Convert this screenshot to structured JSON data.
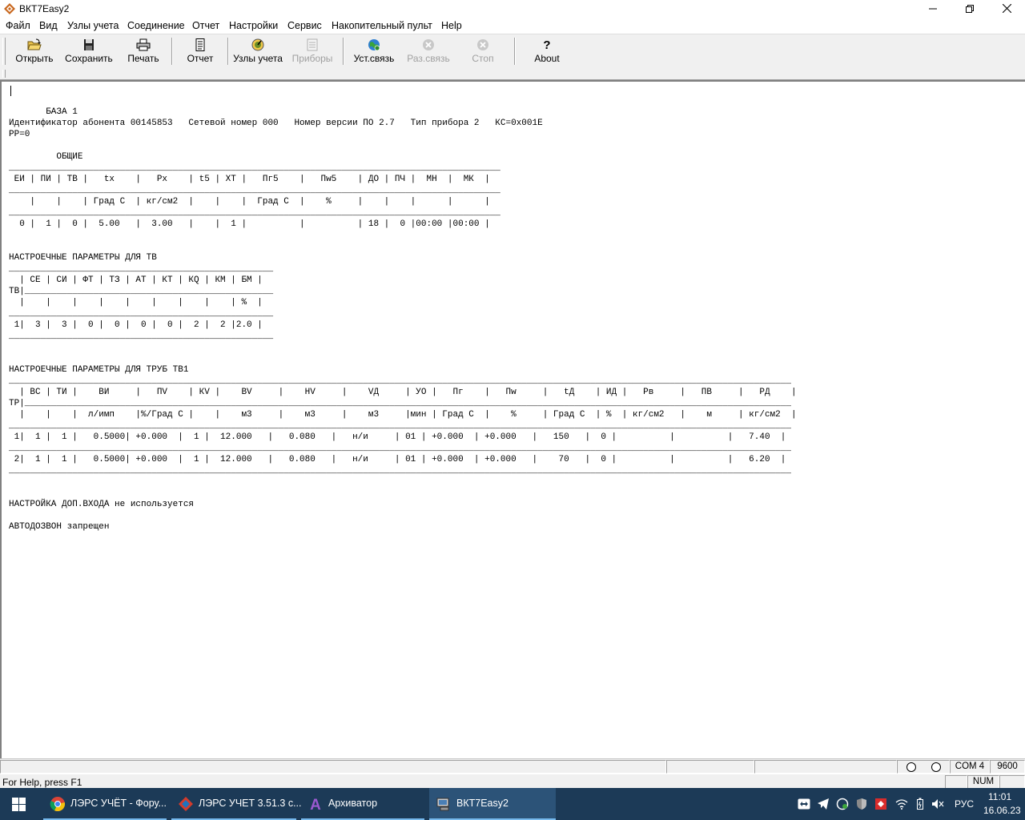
{
  "window": {
    "title": "ВКТ7Easy2"
  },
  "menu": [
    "Файл",
    "Вид",
    "Узлы учета",
    "Соединение",
    "Отчет",
    "Настройки",
    "Сервис",
    "Накопительный пульт",
    "Help"
  ],
  "toolbar": {
    "open": "Открыть",
    "save": "Сохранить",
    "print": "Печать",
    "report": "Отчет",
    "nodes": "Узлы учета",
    "devices": "Приборы",
    "connect": "Уст.связь",
    "disconnect": "Раз.связь",
    "stop": "Стоп",
    "about": "About"
  },
  "document": {
    "lines": [
      "",
      "       БАЗА 1",
      "Идентификатор абонента 00145853   Сетевой номер 000   Номер версии ПО 2.7   Тип прибора 2   КС=0x001E",
      "РР=0",
      "",
      "         ОБЩИЕ",
      "_____________________________________________________________________________________________",
      " ЕИ | ПИ | ТВ |   tх    |   Рх    | t5 | ХТ |   Пг5    |   Пw5    | ДО | ПЧ |  МН  |  МК  |",
      "_____________________________________________________________________________________________",
      "    |    |    | Град С  | кг/см2  |    |    |  Град С  |    %     |    |    |      |      |",
      "_____________________________________________________________________________________________",
      "  0 |  1 |  0 |  5.00   |  3.00   |    |  1 |          |          | 18 |  0 |00:00 |00:00 |",
      "",
      "",
      "НАСТРОЕЧНЫЕ ПАРАМЕТРЫ ДЛЯ ТВ",
      "__________________________________________________",
      "  | СЕ | СИ | ФТ | ТЗ | АТ | КТ | КQ | КМ | БМ |",
      "ТВ|_______________________________________________",
      "  |    |    |    |    |    |    |    |    | %  |",
      "__________________________________________________",
      " 1|  3 |  3 |  0 |  0 |  0 |  0 |  2 |  2 |2.0 |",
      "__________________________________________________",
      "",
      "",
      "НАСТРОЕЧНЫЕ ПАРАМЕТРЫ ДЛЯ ТРУБ ТВ1",
      "____________________________________________________________________________________________________________________________________________________",
      "  | ВС | ТИ |    ВИ     |   ПV    | КV |    ВV     |    НV     |    VД     | УО |   Пг    |   Пw     |   tД    | ИД |   Рв     |   ПВ     |   РД    |",
      "ТР|_________________________________________________________________________________________________________________________________________________",
      "  |    |    |  л/имп    |%/Град С |    |    м3     |    м3     |    м3     |мин | Град С  |    %     | Град С  | %  | кг/см2   |    м     | кг/см2  |",
      "____________________________________________________________________________________________________________________________________________________",
      " 1|  1 |  1 |   0.5000| +0.000  |  1 |  12.000   |   0.080   |   н/и     | 01 | +0.000  | +0.000   |   150   |  0 |          |          |   7.40  |",
      "____________________________________________________________________________________________________________________________________________________",
      " 2|  1 |  1 |   0.5000| +0.000  |  1 |  12.000   |   0.080   |   н/и     | 01 | +0.000  | +0.000   |    70   |  0 |          |          |   6.20  |",
      "____________________________________________________________________________________________________________________________________________________",
      "",
      "",
      "НАСТРОЙКА ДОП.ВХОДА не используется",
      "",
      "АВТОДОЗВОН запрещен"
    ]
  },
  "status": {
    "port": "COM 4",
    "baud": "9600",
    "help": "For Help, press F1",
    "num": "NUM"
  },
  "taskbar": {
    "tasks": [
      "ЛЭРС УЧЁТ - Фору...",
      "ЛЭРС УЧЕТ 3.51.3 с...",
      "Архиватор",
      "ВКТ7Easy2"
    ],
    "lang": "РУС",
    "time": "11:01",
    "date": "16.06.23"
  }
}
